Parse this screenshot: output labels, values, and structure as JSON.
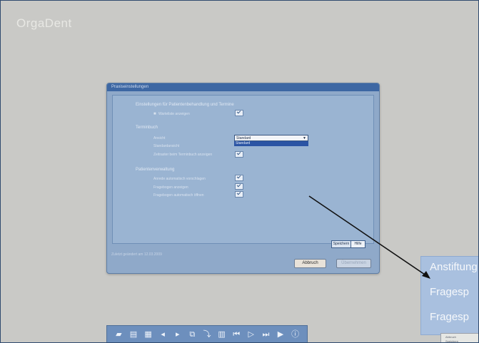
{
  "app": {
    "logo": "OrgaDent"
  },
  "dialog": {
    "title": "Praxiseinstellungen",
    "sections": [
      {
        "title": "Einstellungen für Patientenbehandlung und Termine"
      },
      {
        "title": "Terminbuch"
      },
      {
        "title": "Patientenverwaltung"
      }
    ],
    "rows": [
      {
        "label": "Warteliste anzeigen"
      },
      {
        "label": "Ansicht"
      },
      {
        "label": "Standardansicht"
      },
      {
        "label": "Zeitraster beim Terminbuch anzeigen"
      },
      {
        "label": "Anrede automatisch vorschlagen"
      },
      {
        "label": "Fragebogen anzeigen"
      },
      {
        "label": "Fragebogen automatisch öffnen"
      }
    ],
    "select": {
      "value": "Standard",
      "option_highlighted": "Standard"
    },
    "tabs": {
      "primary": "Speichern",
      "secondary": "Hilfe"
    },
    "status": "Zuletzt geändert am 12.03.2009",
    "buttons": {
      "primary": "Abbruch",
      "secondary": "Übernehmen"
    }
  },
  "zoom": {
    "lines": [
      "Anstiftung",
      "Fragesp",
      "Fragesp"
    ]
  },
  "corner": {
    "line1": "Abbruch",
    "line2": "Speichern"
  },
  "taskbar": {
    "icons": [
      "new-icon",
      "save-icon",
      "print-icon",
      "back-icon",
      "forward-icon",
      "copy-icon",
      "export-icon",
      "calendar-icon",
      "first-icon",
      "next-icon",
      "last-icon",
      "end-icon",
      "info-icon"
    ]
  }
}
